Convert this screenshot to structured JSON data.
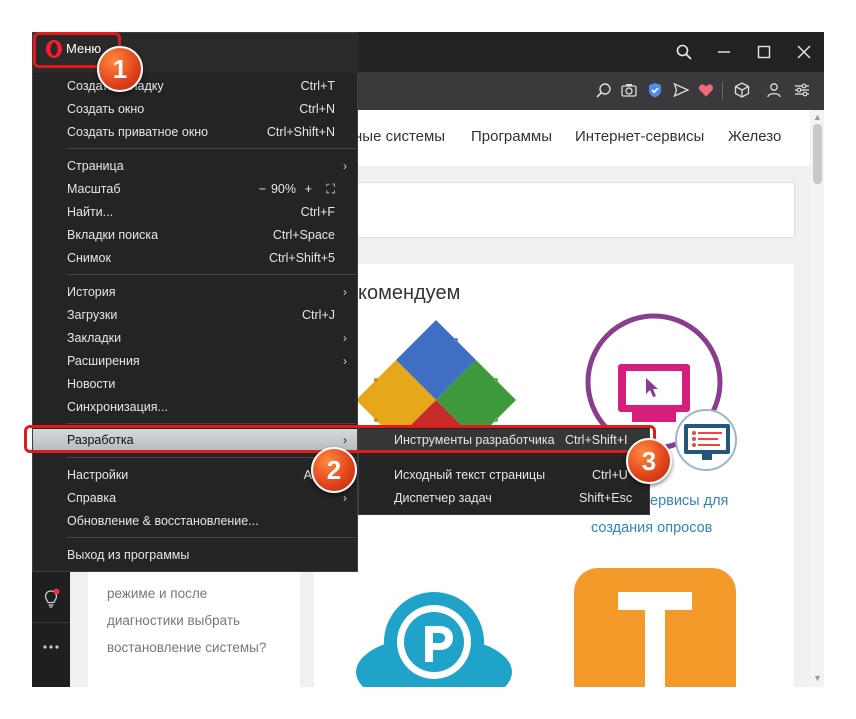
{
  "window": {
    "menu_button_label": "Меню"
  },
  "nav": {
    "items": [
      "ные системы",
      "Программы",
      "Интернет-сервисы",
      "Железо"
    ]
  },
  "main": {
    "heading": "комендуем",
    "card_right_link_line1": "ервисы для",
    "card_right_link_line2": "создания опросов",
    "left_card_text": [
      "режиме и после",
      "диагностики выбрать",
      "востановление системы?"
    ]
  },
  "menu": {
    "items": [
      {
        "label": "Создать вкладку",
        "shortcut": "Ctrl+T"
      },
      {
        "label": "Создать окно",
        "shortcut": "Ctrl+N"
      },
      {
        "label": "Создать приватное окно",
        "shortcut": "Ctrl+Shift+N"
      },
      {
        "label": "Страница",
        "shortcut": ""
      },
      {
        "label": "Масштаб",
        "shortcut": ""
      },
      {
        "label": "Найти...",
        "shortcut": "Ctrl+F"
      },
      {
        "label": "Вкладки поиска",
        "shortcut": "Ctrl+Space"
      },
      {
        "label": "Снимок",
        "shortcut": "Ctrl+Shift+5"
      },
      {
        "label": "История",
        "shortcut": ""
      },
      {
        "label": "Загрузки",
        "shortcut": "Ctrl+J"
      },
      {
        "label": "Закладки",
        "shortcut": ""
      },
      {
        "label": "Расширения",
        "shortcut": ""
      },
      {
        "label": "Новости",
        "shortcut": ""
      },
      {
        "label": "Синхронизация...",
        "shortcut": ""
      },
      {
        "label": "Разработка",
        "shortcut": ""
      },
      {
        "label": "Настройки",
        "shortcut": "A"
      },
      {
        "label": "Справка",
        "shortcut": ""
      },
      {
        "label": "Обновление & восстановление...",
        "shortcut": ""
      },
      {
        "label": "Выход из программы",
        "shortcut": ""
      }
    ],
    "zoom": {
      "minus": "−",
      "value": "90%",
      "plus": "+",
      "fullscreen": "⛶"
    }
  },
  "submenu": {
    "items": [
      {
        "label": "Инструменты разработчика",
        "shortcut": "Ctrl+Shift+I"
      },
      {
        "label": "Исходный текст страницы",
        "shortcut": "Ctrl+U"
      },
      {
        "label": "Диспетчер задач",
        "shortcut": "Shift+Esc"
      }
    ]
  },
  "badges": [
    "1",
    "2",
    "3"
  ],
  "colors": {
    "highlight": "#e01b1b",
    "opera_red": "#ff1b2d",
    "badge_orange": "#e0401a",
    "link_blue": "#2e86c1"
  },
  "icons": [
    "search-icon",
    "minimize-icon",
    "maximize-icon",
    "close-icon",
    "zoom-icon",
    "camera-icon",
    "shield-icon",
    "send-icon",
    "heart-icon",
    "cube-icon",
    "user-icon",
    "settings-icon",
    "lightbulb-icon",
    "more-icon"
  ]
}
